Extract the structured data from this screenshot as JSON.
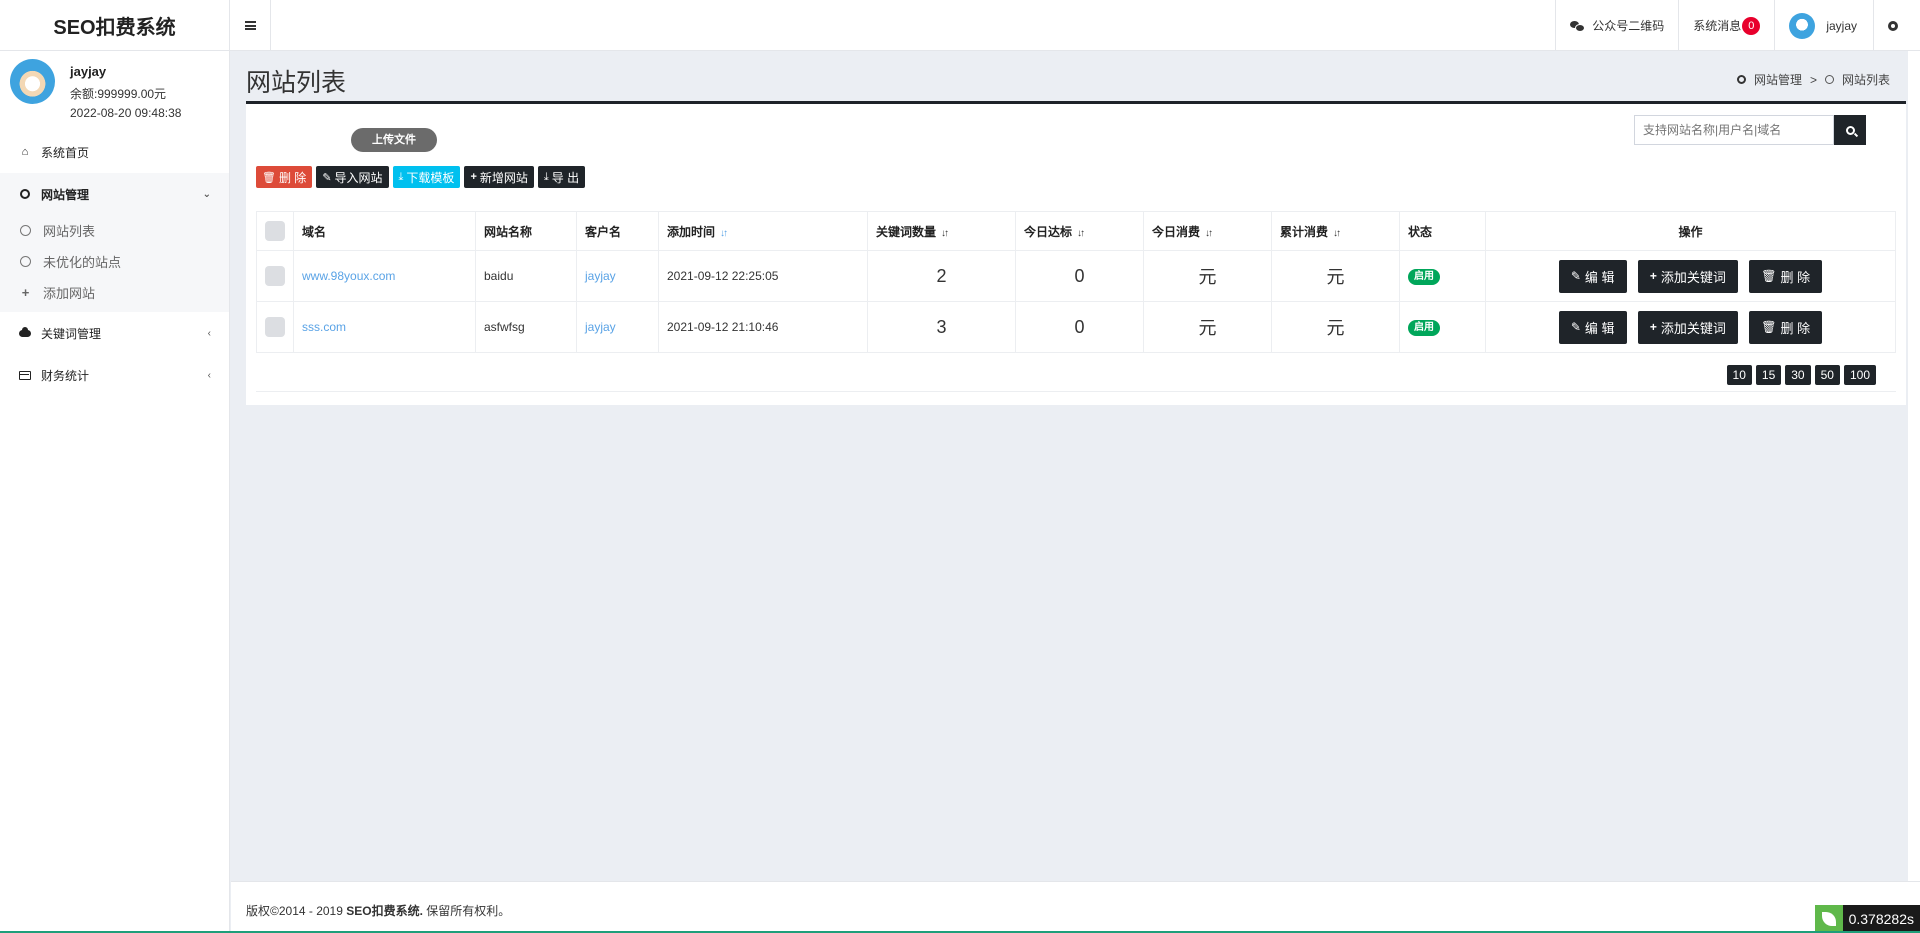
{
  "header": {
    "brand": "SEO扣费系统",
    "wechat_label": "公众号二维码",
    "messages_label": "系统消息",
    "messages_count": "0",
    "username": "jayjay"
  },
  "sidebar": {
    "user": {
      "name": "jayjay",
      "balance": "余额:999999.00元",
      "datetime": "2022-08-20 09:48:38"
    },
    "home": "系统首页",
    "site_mgmt": "网站管理",
    "sub_items": [
      "网站列表",
      "未优化的站点",
      "添加网站"
    ],
    "keyword_mgmt": "关键词管理",
    "finance": "财务统计"
  },
  "main": {
    "title": "网站列表",
    "breadcrumb": [
      "网站管理",
      "网站列表"
    ],
    "upload_label": "上传文件",
    "toolbar": {
      "delete": "删 除",
      "import": "导入网站",
      "download": "下载模板",
      "add": "新增网站",
      "export": "导 出"
    },
    "search": {
      "placeholder": "支持网站名称|用户名|域名"
    },
    "table": {
      "headers": [
        "域名",
        "网站名称",
        "客户名",
        "添加时间",
        "关键词数量",
        "今日达标",
        "今日消费",
        "累计消费",
        "状态",
        "操作"
      ],
      "rows": [
        {
          "domain": "www.98youx.com",
          "site_name": "baidu",
          "customer": "jayjay",
          "added": "2021-09-12 22:25:05",
          "keywords": "2",
          "today_ok": "0",
          "today_cost": "元",
          "total_cost": "元",
          "status": "启用"
        },
        {
          "domain": "sss.com",
          "site_name": "asfwfsg",
          "customer": "jayjay",
          "added": "2021-09-12 21:10:46",
          "keywords": "3",
          "today_ok": "0",
          "today_cost": "元",
          "total_cost": "元",
          "status": "启用"
        }
      ],
      "ops": {
        "edit": "编 辑",
        "add_keyword": "添加关键词",
        "delete": "删 除"
      }
    },
    "page_sizes": [
      "10",
      "15",
      "30",
      "50",
      "100"
    ]
  },
  "footer": {
    "prefix": "版权©2014 - 2019 ",
    "brand": "SEO扣费系统.",
    "suffix": " 保留所有权利。",
    "timer": "0.378282s"
  },
  "colors": {
    "accent_dark": "#1f2429",
    "danger": "#dd4b39",
    "info": "#00c0ef",
    "success": "#00a65a",
    "link": "#5aa3e6"
  }
}
